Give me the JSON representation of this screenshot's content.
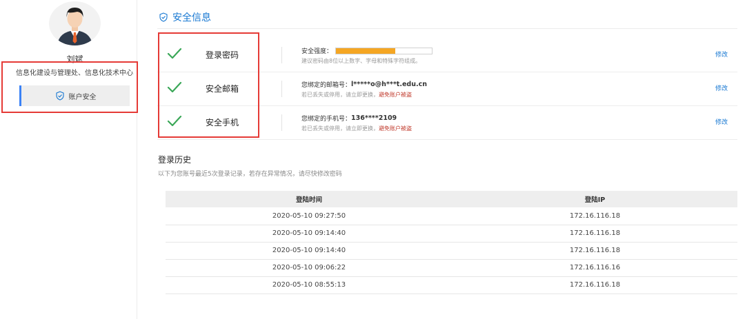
{
  "user": {
    "name": "刘斌",
    "department": "信息化建设与管理处、信息化技术中心"
  },
  "sidebar": {
    "menu": [
      {
        "label": "账户安全",
        "icon": "shield-check-icon",
        "active": true
      }
    ]
  },
  "security": {
    "title": "安全信息",
    "icon": "shield-check-icon",
    "rows": [
      {
        "label": "登录密码",
        "status_icon": "check-icon",
        "line1_prefix": "安全强度：",
        "strength": 0.62,
        "line2": "建议密码由8位以上数字、字母和特殊字符组成。",
        "edit": "修改"
      },
      {
        "label": "安全邮箱",
        "status_icon": "check-icon",
        "line1_prefix": "您绑定的邮箱号：",
        "line1_value": "l*****o@h***t.edu.cn",
        "line2": "若已丢失或停用，请立即更换，",
        "line2_warn": "避免账户被盗",
        "edit": "修改"
      },
      {
        "label": "安全手机",
        "status_icon": "check-icon",
        "line1_prefix": "您绑定的手机号：",
        "line1_value": "136****2109",
        "line2": "若已丢失或停用，请立即更换，",
        "line2_warn": "避免账户被盗",
        "edit": "修改"
      }
    ]
  },
  "history": {
    "title": "登录历史",
    "description": "以下为您账号最近5次登录记录，若存在异常情况，请尽快修改密码",
    "columns": [
      "登陆时间",
      "登陆IP"
    ],
    "rows": [
      [
        "2020-05-10 09:27:50",
        "172.16.116.18"
      ],
      [
        "2020-05-10 09:14:40",
        "172.16.116.18"
      ],
      [
        "2020-05-10 09:14:40",
        "172.16.116.18"
      ],
      [
        "2020-05-10 09:06:22",
        "172.16.116.16"
      ],
      [
        "2020-05-10 08:55:13",
        "172.16.116.18"
      ]
    ]
  },
  "colors": {
    "accent": "#1677d2",
    "check": "#3aa757",
    "strength": "#f5a623",
    "highlight": "#e53935",
    "warning": "#c0392b"
  }
}
